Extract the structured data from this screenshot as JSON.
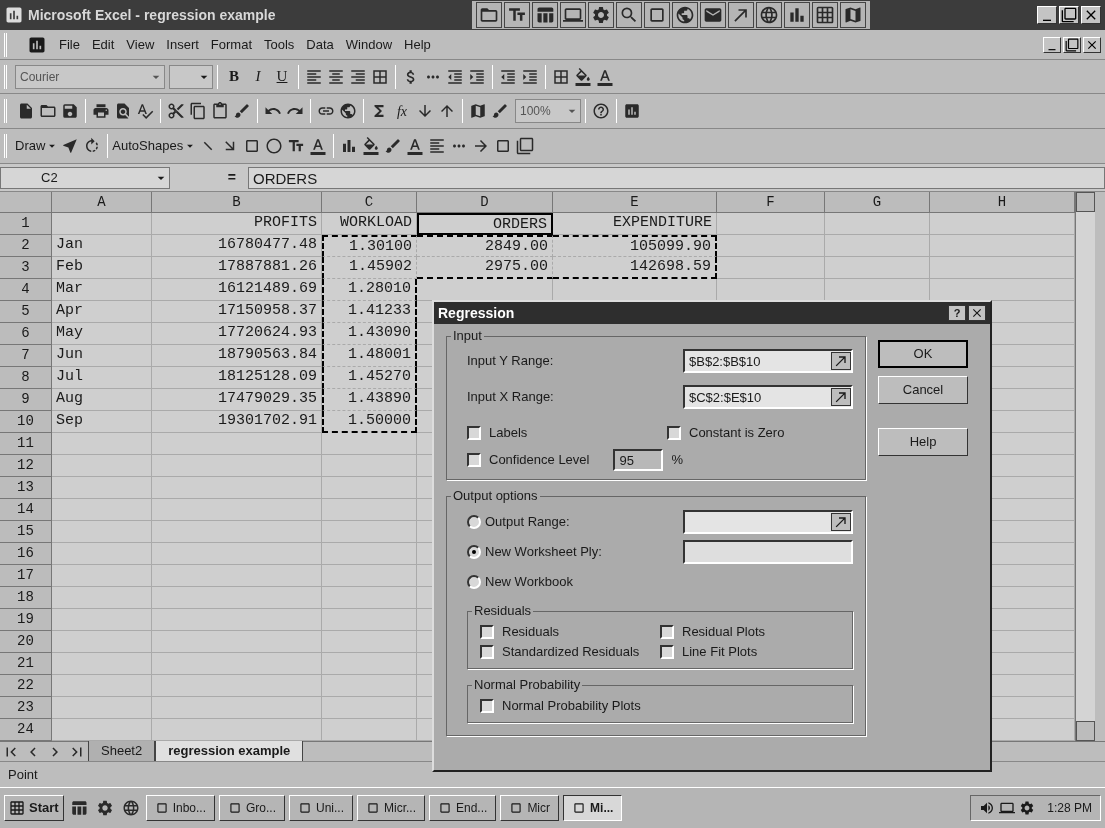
{
  "window": {
    "title": "Microsoft Excel - regression example"
  },
  "menu": {
    "items": [
      "File",
      "Edit",
      "View",
      "Insert",
      "Format",
      "Tools",
      "Data",
      "Window",
      "Help"
    ]
  },
  "format_toolbar": {
    "font": "Courier",
    "bold": "B",
    "italic": "I",
    "underline": "U"
  },
  "standard_toolbar": {
    "function": "fx",
    "zoom": "100%"
  },
  "drawing_toolbar": {
    "draw": "Draw",
    "autoshapes": "AutoShapes"
  },
  "formula_bar": {
    "cell": "C2",
    "equals": "=",
    "content": "ORDERS"
  },
  "grid": {
    "columns": [
      "A",
      "B",
      "C",
      "D",
      "E",
      "F",
      "G",
      "H"
    ],
    "rows": [
      {
        "header": "1",
        "cells": [
          null,
          {
            "text": "PROFITS",
            "active": false,
            "marquee": false
          },
          {
            "text": "WORKLOAD",
            "active": false,
            "marquee": false
          },
          {
            "text": "ORDERS",
            "active": true,
            "marquee": false
          },
          {
            "text": "EXPENDITURE",
            "active": false,
            "marquee": false
          }
        ]
      },
      {
        "header": "2",
        "cells": [
          {
            "text": "Jan",
            "active": false,
            "marquee": false
          },
          {
            "text": "16780477.48",
            "active": false,
            "marquee": false
          },
          {
            "text": "1.30100",
            "active": false,
            "marquee": true
          },
          {
            "text": "2849.00",
            "active": false,
            "marquee": true
          },
          {
            "text": "105099.90",
            "active": false,
            "marquee": true
          }
        ]
      },
      {
        "header": "3",
        "cells": [
          {
            "text": "Feb",
            "active": false,
            "marquee": false
          },
          {
            "text": "17887881.26",
            "active": false,
            "marquee": false
          },
          {
            "text": "1.45902",
            "active": false,
            "marquee": true
          },
          {
            "text": "2975.00",
            "active": false,
            "marquee": true
          },
          {
            "text": "142698.59",
            "active": false,
            "marquee": true
          }
        ]
      },
      {
        "header": "4",
        "cells": [
          {
            "text": "Mar",
            "active": false,
            "marquee": false
          },
          {
            "text": "16121489.69",
            "active": false,
            "marquee": false
          },
          {
            "text": "1.28010",
            "active": false,
            "marquee": true
          }
        ]
      },
      {
        "header": "5",
        "cells": [
          {
            "text": "Apr",
            "active": false,
            "marquee": false
          },
          {
            "text": "17150958.37",
            "active": false,
            "marquee": false
          },
          {
            "text": "1.41233",
            "active": false,
            "marquee": true
          }
        ]
      },
      {
        "header": "6",
        "cells": [
          {
            "text": "May",
            "active": false,
            "marquee": false
          },
          {
            "text": "17720624.93",
            "active": false,
            "marquee": false
          },
          {
            "text": "1.43090",
            "active": false,
            "marquee": true
          }
        ]
      },
      {
        "header": "7",
        "cells": [
          {
            "text": "Jun",
            "active": false,
            "marquee": false
          },
          {
            "text": "18790563.84",
            "active": false,
            "marquee": false
          },
          {
            "text": "1.48001",
            "active": false,
            "marquee": true
          }
        ]
      },
      {
        "header": "8",
        "cells": [
          {
            "text": "Jul",
            "active": false,
            "marquee": false
          },
          {
            "text": "18125128.09",
            "active": false,
            "marquee": false
          },
          {
            "text": "1.45270",
            "active": false,
            "marquee": true
          }
        ]
      },
      {
        "header": "9",
        "cells": [
          {
            "text": "Aug",
            "active": false,
            "marquee": false
          },
          {
            "text": "17479029.35",
            "active": false,
            "marquee": false
          },
          {
            "text": "1.43890",
            "active": false,
            "marquee": true
          }
        ]
      },
      {
        "header": "10",
        "cells": [
          {
            "text": "Sep",
            "active": false,
            "marquee": false
          },
          {
            "text": "19301702.91",
            "active": false,
            "marquee": false
          },
          {
            "text": "1.50000",
            "active": false,
            "marquee": true
          }
        ]
      },
      {
        "header": "11"
      },
      {
        "header": "12"
      },
      {
        "header": "13"
      },
      {
        "header": "14"
      },
      {
        "header": "15"
      },
      {
        "header": "16"
      },
      {
        "header": "17"
      },
      {
        "header": "18"
      },
      {
        "header": "19"
      },
      {
        "header": "20"
      },
      {
        "header": "21"
      },
      {
        "header": "22"
      },
      {
        "header": "23"
      },
      {
        "header": "24"
      }
    ]
  },
  "sheet_tabs": [
    {
      "label": "Sheet2",
      "selected": false
    },
    {
      "label": "regression example",
      "selected": true
    }
  ],
  "status_bar": {
    "text": "Point"
  },
  "dialog": {
    "title": "Regression",
    "help": "?",
    "input": {
      "legend": "Input",
      "fields": [
        {
          "label": "Input Y Range:",
          "value": "$B$2:$B$10"
        },
        {
          "label": "Input X Range:",
          "value": "$C$2:$E$10"
        }
      ],
      "options": [
        {
          "label": "Labels",
          "checked": false
        },
        {
          "label": "Constant is Zero",
          "checked": false
        },
        {
          "label": "Confidence Level",
          "checked": false
        }
      ],
      "confidence": {
        "value": "95",
        "unit": "%"
      }
    },
    "buttons": [
      {
        "label": "OK",
        "default": true
      },
      {
        "label": "Cancel",
        "default": false
      },
      {
        "label": "Help",
        "default": false
      }
    ],
    "output": {
      "legend": "Output options",
      "choices": [
        {
          "label": "Output Range:",
          "selected": false,
          "kind": "range"
        },
        {
          "label": "New Worksheet Ply:",
          "selected": true,
          "kind": "text"
        },
        {
          "label": "New Workbook",
          "selected": false,
          "kind": "plain"
        }
      ],
      "residuals": {
        "legend": "Residuals",
        "options": [
          {
            "label": "Residuals",
            "checked": false
          },
          {
            "label": "Residual Plots",
            "checked": false
          },
          {
            "label": "Standardized Residuals",
            "checked": false
          },
          {
            "label": "Line Fit Plots",
            "checked": false
          }
        ]
      },
      "normal": {
        "legend": "Normal Probability",
        "options": [
          {
            "label": "Normal Probability Plots",
            "checked": false
          }
        ]
      }
    }
  },
  "taskbar": {
    "start": "Start",
    "tasks": [
      {
        "label": "Inbo...",
        "selected": false
      },
      {
        "label": "Gro...",
        "selected": false
      },
      {
        "label": "Uni...",
        "selected": false
      },
      {
        "label": "Micr...",
        "selected": false
      },
      {
        "label": "End...",
        "selected": false
      },
      {
        "label": "Micr",
        "selected": false
      },
      {
        "label": "Mi...",
        "selected": true
      }
    ],
    "clock": "1:28 PM"
  }
}
